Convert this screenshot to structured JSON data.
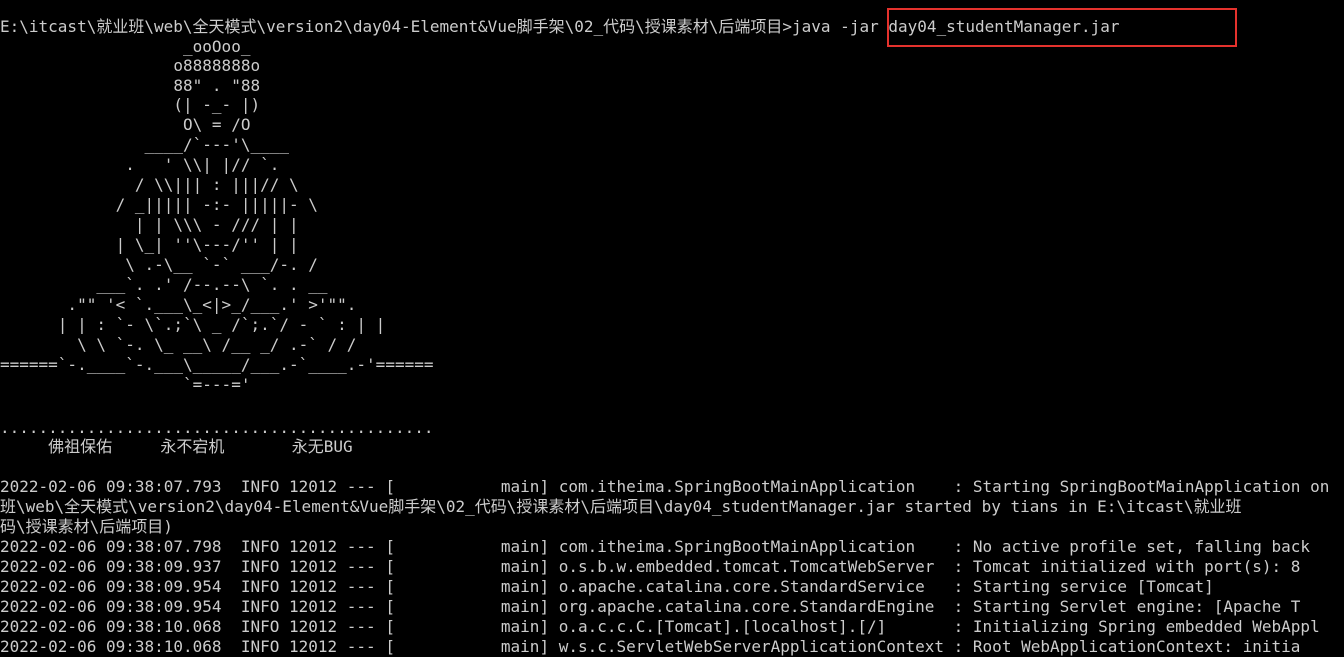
{
  "prompt": {
    "path": "E:\\itcast\\就业班\\web\\全天模式\\version2\\day04-Element&Vue脚手架\\02_代码\\授课素材\\后端项目>",
    "command": "java -jar day04_studentManager.jar"
  },
  "banner": [
    "                   _ooOoo_",
    "                  o8888888o",
    "                  88\" . \"88",
    "                  (| -_- |)",
    "                   O\\ = /O",
    "               ____/`---'\\____",
    "             .   ' \\\\| |// `.",
    "              / \\\\||| : |||// \\",
    "            / _||||| -:- |||||- \\",
    "              | | \\\\\\ - /// | |",
    "            | \\_| ''\\---/'' | |",
    "             \\ .-\\__ `-` ___/-. /",
    "          ___`. .' /--.--\\ `. . __",
    "       .\"\" '< `.___\\_<|>_/___.' >'\"\".",
    "      | | : `- \\`.;`\\ _ /`;.`/ - ` : | |",
    "        \\ \\ `-. \\_ __\\ /__ _/ .-` / /",
    "======`-.____`-.___\\_____/___.-`____.-'======",
    "                   `=---='"
  ],
  "dotted_line": ".............................................",
  "blessing": "     佛祖保佑     永不宕机       永无BUG",
  "log_lines": [
    "2022-02-06 09:38:07.793  INFO 12012 --- [           main] com.itheima.SpringBootMainApplication    : Starting SpringBootMainApplication on",
    "班\\web\\全天模式\\version2\\day04-Element&Vue脚手架\\02_代码\\授课素材\\后端项目\\day04_studentManager.jar started by tians in E:\\itcast\\就业班",
    "码\\授课素材\\后端项目)",
    "2022-02-06 09:38:07.798  INFO 12012 --- [           main] com.itheima.SpringBootMainApplication    : No active profile set, falling back",
    "2022-02-06 09:38:09.937  INFO 12012 --- [           main] o.s.b.w.embedded.tomcat.TomcatWebServer  : Tomcat initialized with port(s): 8",
    "2022-02-06 09:38:09.954  INFO 12012 --- [           main] o.apache.catalina.core.StandardService   : Starting service [Tomcat]",
    "2022-02-06 09:38:09.954  INFO 12012 --- [           main] org.apache.catalina.core.StandardEngine  : Starting Servlet engine: [Apache T",
    "2022-02-06 09:38:10.068  INFO 12012 --- [           main] o.a.c.c.C.[Tomcat].[localhost].[/]       : Initializing Spring embedded WebAppl",
    "2022-02-06 09:38:10.068  INFO 12012 --- [           main] w.s.c.ServletWebServerApplicationContext : Root WebApplicationContext: initia"
  ],
  "colors": {
    "background": "#000000",
    "text": "#cccccc",
    "highlight_border": "#e5322d"
  }
}
